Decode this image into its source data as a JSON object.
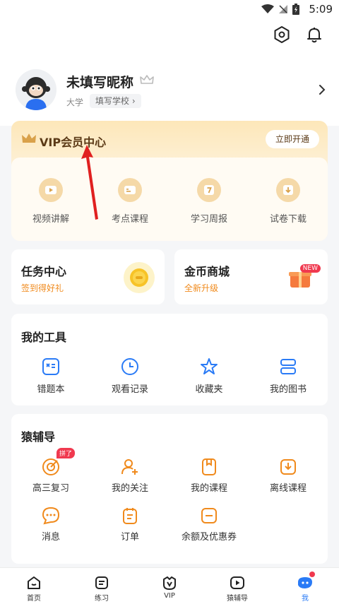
{
  "status_bar": {
    "time": "5:09"
  },
  "profile": {
    "nickname": "未填写昵称",
    "school_label": "大学",
    "school_button": "填写学校"
  },
  "vip": {
    "title": "VIP会员中心",
    "open_button": "立即开通",
    "items": [
      {
        "label": "视频讲解",
        "icon": "play-icon"
      },
      {
        "label": "考点课程",
        "icon": "card-icon"
      },
      {
        "label": "学习周报",
        "icon": "calendar-7-icon"
      },
      {
        "label": "试卷下载",
        "icon": "download-icon"
      }
    ]
  },
  "task_center": {
    "title": "任务中心",
    "subtitle": "签到得好礼"
  },
  "coin_mall": {
    "title": "金币商城",
    "subtitle": "全新升级",
    "badge": "NEW"
  },
  "tools": {
    "title": "我的工具",
    "items": [
      {
        "label": "错题本",
        "icon": "wrong-book-icon"
      },
      {
        "label": "观看记录",
        "icon": "clock-icon"
      },
      {
        "label": "收藏夹",
        "icon": "star-icon"
      },
      {
        "label": "我的图书",
        "icon": "books-icon"
      }
    ]
  },
  "yuanfudao": {
    "title": "猿辅导",
    "row1": [
      {
        "label": "高三复习",
        "icon": "target-icon",
        "badge": "拼了"
      },
      {
        "label": "我的关注",
        "icon": "follow-icon"
      },
      {
        "label": "我的课程",
        "icon": "course-icon"
      },
      {
        "label": "离线课程",
        "icon": "offline-icon"
      }
    ],
    "row2": [
      {
        "label": "消息",
        "icon": "message-icon"
      },
      {
        "label": "订单",
        "icon": "order-icon"
      },
      {
        "label": "余额及优惠券",
        "icon": "balance-icon"
      }
    ]
  },
  "tabbar": [
    {
      "label": "首页"
    },
    {
      "label": "练习"
    },
    {
      "label": "VIP"
    },
    {
      "label": "猿辅导"
    },
    {
      "label": "我"
    }
  ],
  "colors": {
    "accent": "#2a7bf6",
    "orange": "#f08a1c",
    "gold_text": "#5b3a17",
    "badge": "#f0394f"
  }
}
